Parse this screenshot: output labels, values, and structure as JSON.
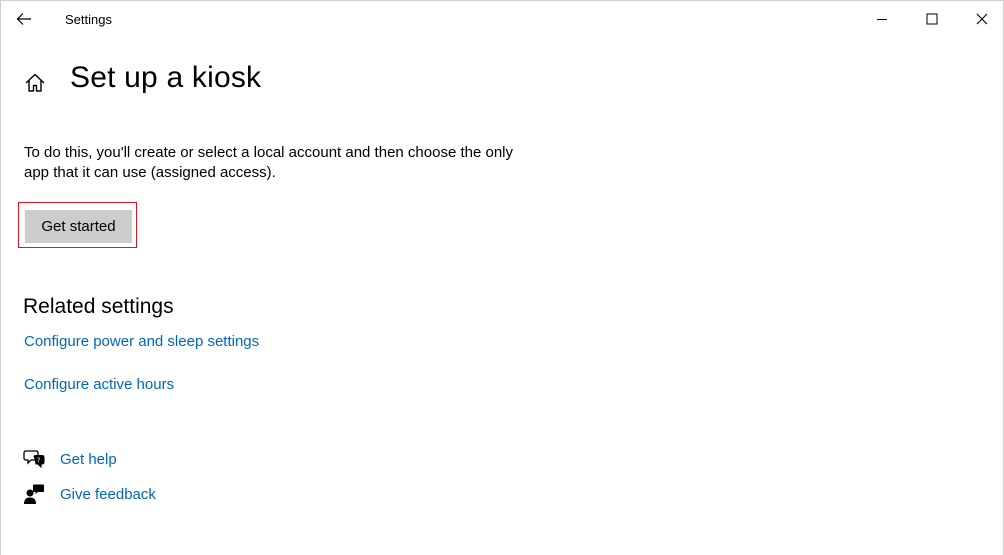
{
  "window": {
    "title": "Settings"
  },
  "page": {
    "title": "Set up a kiosk",
    "description": "To do this, you'll create or select a local account and then choose the only app that it can use (assigned access).",
    "get_started_label": "Get started"
  },
  "related": {
    "heading": "Related settings",
    "links": [
      {
        "label": "Configure power and sleep settings"
      },
      {
        "label": "Configure active hours"
      }
    ]
  },
  "help": {
    "get_help": "Get help",
    "give_feedback": "Give feedback"
  },
  "colors": {
    "link": "#0067b8",
    "button_bg": "#cccccc",
    "highlight": "#e81123"
  },
  "icons": {
    "back": "arrow-left-icon",
    "home": "home-icon",
    "minimize": "minimize-icon",
    "maximize": "maximize-icon",
    "close": "close-icon",
    "get_help": "chat-question-icon",
    "give_feedback": "person-feedback-icon"
  }
}
